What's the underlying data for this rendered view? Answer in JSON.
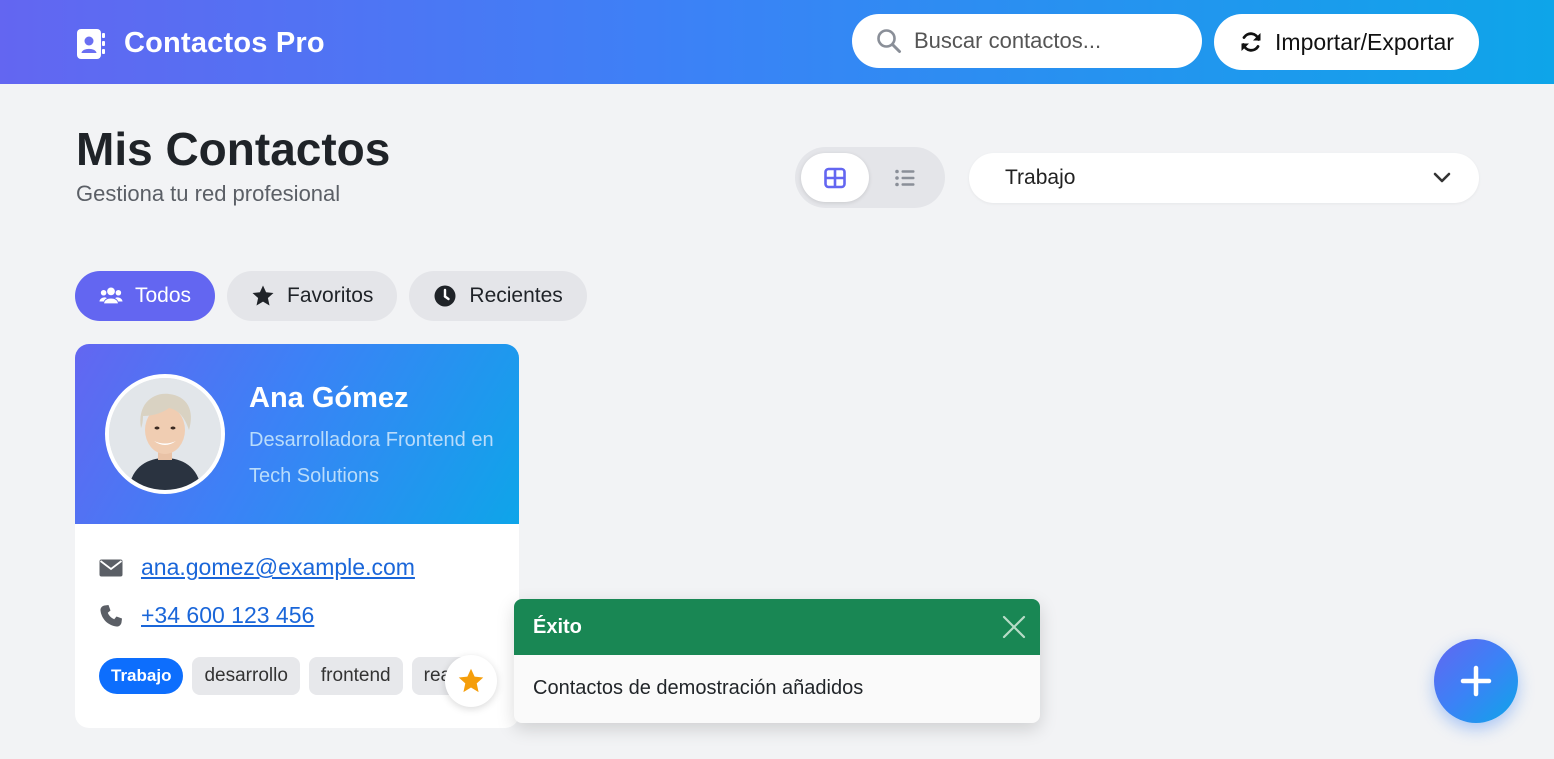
{
  "header": {
    "app_title": "Contactos Pro",
    "search_placeholder": "Buscar contactos...",
    "import_export_label": "Importar/Exportar"
  },
  "page": {
    "title": "Mis Contactos",
    "subtitle": "Gestiona tu red profesional"
  },
  "view_toggle": {
    "active": "grid"
  },
  "category_select": {
    "selected": "Trabajo"
  },
  "filters": [
    {
      "label": "Todos",
      "icon": "users-icon",
      "active": true
    },
    {
      "label": "Favoritos",
      "icon": "star-icon",
      "active": false
    },
    {
      "label": "Recientes",
      "icon": "clock-icon",
      "active": false
    }
  ],
  "contact": {
    "name": "Ana Gómez",
    "role": "Desarrolladora Frontend en Tech Solutions",
    "email": "ana.gomez@example.com",
    "phone": "+34 600 123 456",
    "tags": [
      "Trabajo",
      "desarrollo",
      "frontend",
      "react"
    ],
    "favorite": true
  },
  "toast": {
    "title": "Éxito",
    "message": "Contactos de demostración añadidos"
  },
  "colors": {
    "accent": "#6366f1",
    "accent_end": "#0ea5e9",
    "success": "#198754",
    "link": "#1a66d9",
    "star": "#f59e0b"
  }
}
